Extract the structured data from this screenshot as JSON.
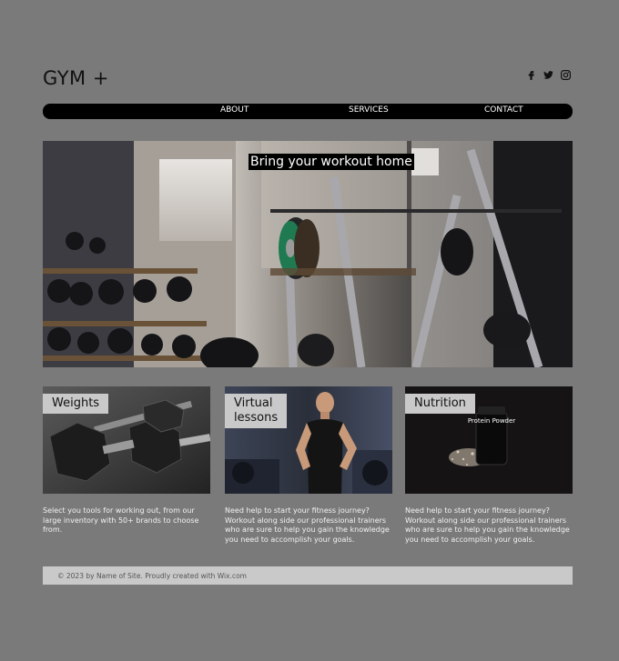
{
  "header": {
    "logo": "GYM +",
    "social_icons": [
      "facebook-icon",
      "twitter-icon",
      "instagram-icon"
    ]
  },
  "nav": {
    "items": [
      {
        "label": "ABOUT"
      },
      {
        "label": "SERVICES"
      },
      {
        "label": "CONTACT"
      }
    ]
  },
  "hero": {
    "title": "Bring your workout home"
  },
  "cards": [
    {
      "label": "Weights",
      "text": "Select you tools for working out, from our large inventory with 50+ brands to choose from."
    },
    {
      "label": "Virtual lessons",
      "text": "Need help to start your fitness journey? Workout along side our professional trainers who are sure to help you gain the knowledge you need to accomplish your goals."
    },
    {
      "label": "Nutrition",
      "text": "Need help to start your fitness journey? Workout along side our professional trainers who are sure to help you gain the knowledge you need to accomplish your goals.",
      "product_label": "Protein Powder"
    }
  ],
  "footer": {
    "text": "© 2023 by Name of Site. Proudly created with Wix.com"
  },
  "colors": {
    "page_bg": "#7a7a7a",
    "nav_bg": "#000000",
    "label_bg": "#c9c9c9",
    "footer_bg": "#c9c9c9"
  }
}
